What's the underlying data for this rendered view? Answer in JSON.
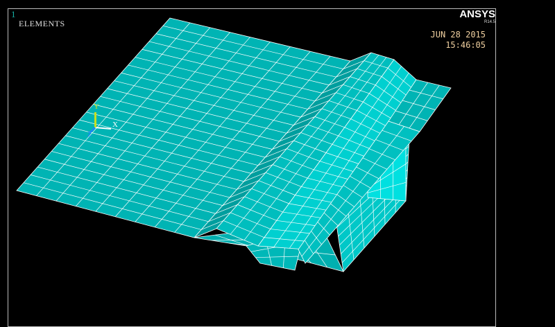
{
  "window_number": "1",
  "plot_title": "ELEMENTS",
  "brand": "ANSYS",
  "version": "R14.5",
  "date": "JUN 28 2015",
  "time": "15:46:05",
  "triad": {
    "x_label": "X",
    "y_label": "Y",
    "z_label": "Z"
  },
  "colors": {
    "mesh_fill": "#00b4b4",
    "mesh_light": "#00e0e0",
    "mesh_line": "#ffffff",
    "background": "#000000"
  }
}
